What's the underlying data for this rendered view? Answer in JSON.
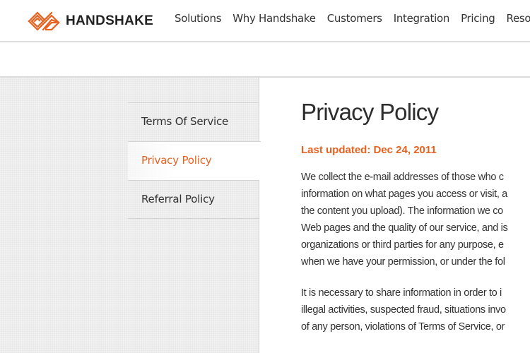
{
  "header": {
    "brand": "HANDSHAKE",
    "logo_icon": "handshake-chevron-logo",
    "brand_color": "#e8611f",
    "nav": [
      "Solutions",
      "Why Handshake",
      "Customers",
      "Integration",
      "Pricing",
      "Resour"
    ]
  },
  "sidebar": {
    "items": [
      {
        "label": "Terms Of Service",
        "active": false
      },
      {
        "label": "Privacy Policy",
        "active": true
      },
      {
        "label": "Referral Policy",
        "active": false
      }
    ]
  },
  "main": {
    "title": "Privacy Policy",
    "last_updated": "Last updated: Dec 24, 2011",
    "paragraphs": [
      [
        "We collect the e-mail addresses of those who c",
        "information on what pages you access or visit, a",
        "the content you upload). The information we co",
        "Web pages and the quality of our service, and is",
        "organizations or third parties for any purpose, e",
        "when we have your permission, or under the fol"
      ],
      [
        "It is necessary to share information in order to i",
        "illegal activities, suspected fraud, situations invo",
        "of any person, violations of Terms of Service, or"
      ]
    ]
  }
}
